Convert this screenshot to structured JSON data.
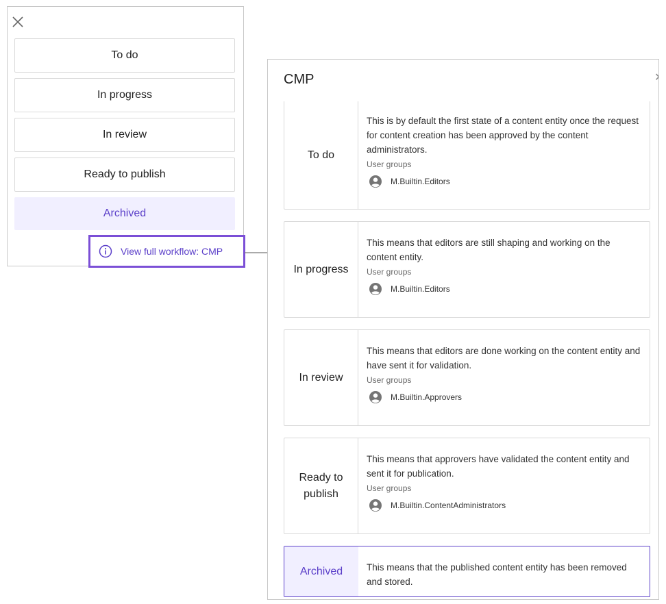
{
  "left_panel": {
    "states": [
      "To do",
      "In progress",
      "In review",
      "Ready to publish",
      "Archived"
    ],
    "selected_state": "Archived",
    "view_workflow_label": "View full workflow: CMP"
  },
  "right_panel": {
    "title": "CMP",
    "user_groups_label": "User groups",
    "cards": [
      {
        "label": "To do",
        "description": "This is by default the first state of a content entity once the request for content creation has been approved by the content administrators.",
        "group": "M.Builtin.Editors"
      },
      {
        "label": "In progress",
        "description": "This means that editors are still shaping and working on the content entity.",
        "group": "M.Builtin.Editors"
      },
      {
        "label": "In review",
        "description": "This means that editors are done working on the content entity and have sent it for validation.",
        "group": "M.Builtin.Approvers"
      },
      {
        "label": "Ready to publish",
        "description": "This means that approvers have validated the content entity and sent it for publication.",
        "group": "M.Builtin.ContentAdministrators"
      },
      {
        "label": "Archived",
        "description": "This means that the published content entity has been removed and stored."
      }
    ]
  },
  "colors": {
    "accent": "#5b3fc9",
    "highlight_border": "#7b4fd6",
    "selected_bg": "#f1efff"
  }
}
